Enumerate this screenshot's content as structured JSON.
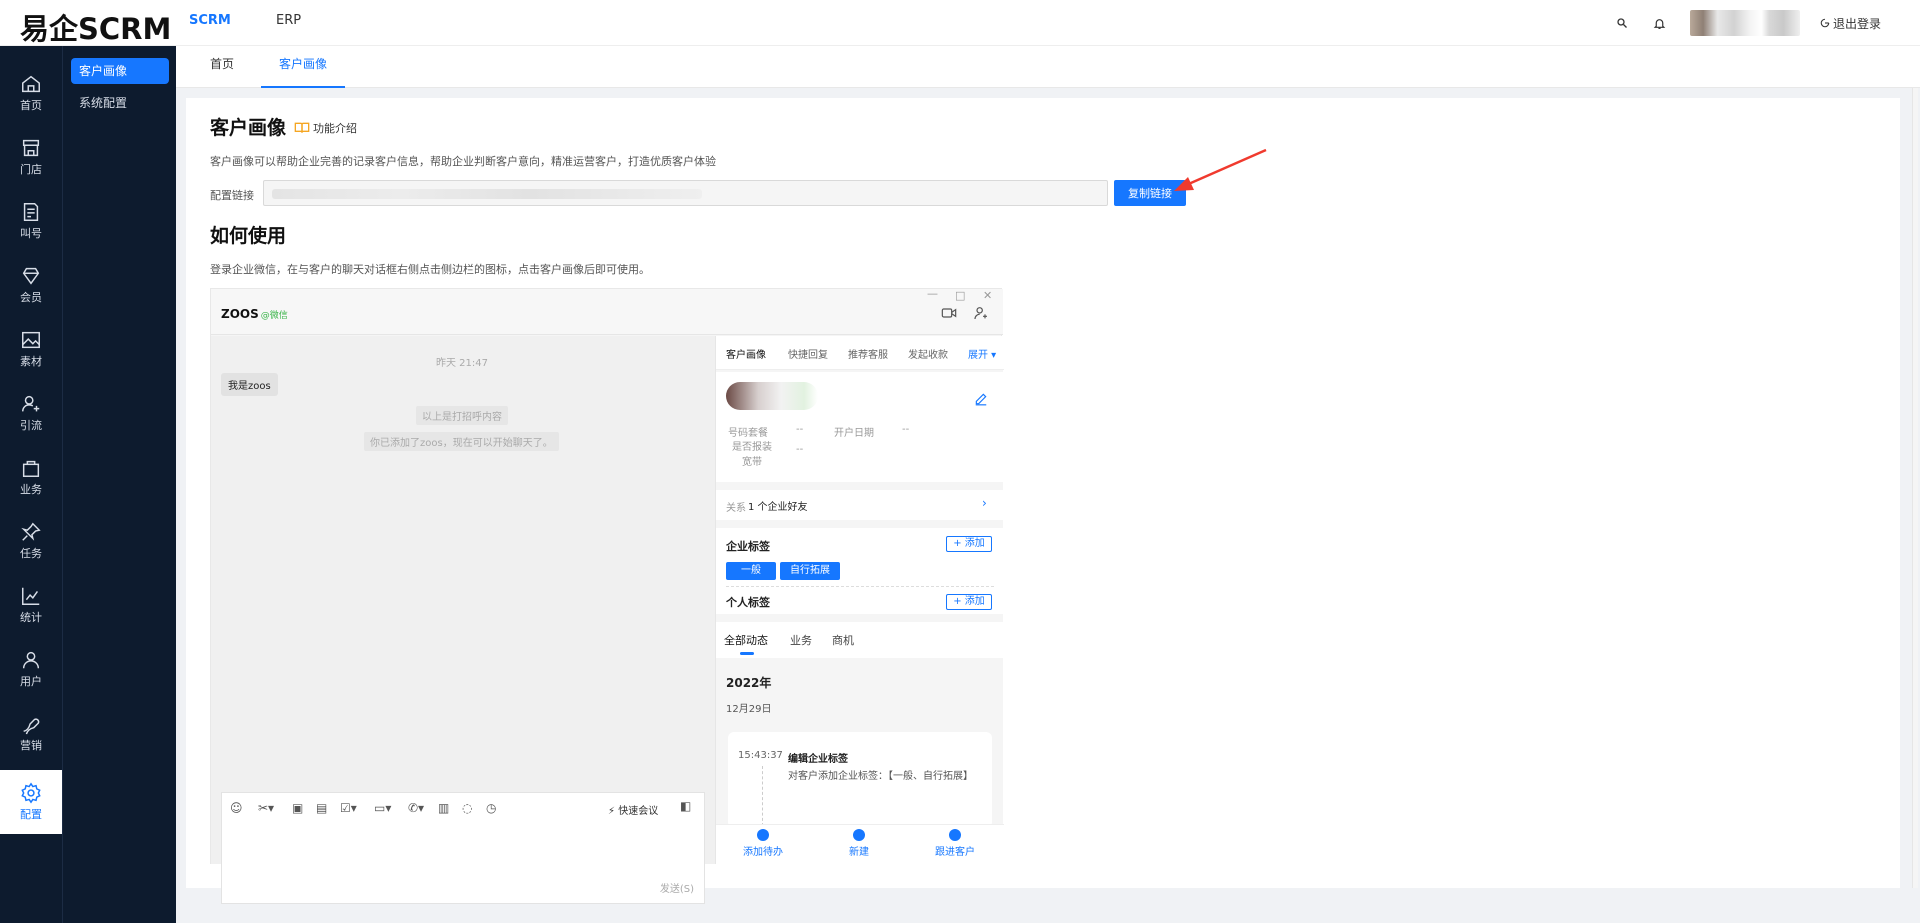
{
  "app": {
    "logo": "易企SCRM"
  },
  "topnav": [
    {
      "label": "SCRM"
    },
    {
      "label": "ERP"
    }
  ],
  "header_right": {
    "logout_label": "退出登录"
  },
  "sidebar": {
    "items": [
      {
        "label": "首页",
        "icon": "home-icon"
      },
      {
        "label": "门店",
        "icon": "store-icon"
      },
      {
        "label": "叫号",
        "icon": "ticket-icon"
      },
      {
        "label": "会员",
        "icon": "member-icon"
      },
      {
        "label": "素材",
        "icon": "image-icon"
      },
      {
        "label": "引流",
        "icon": "user-add-icon"
      },
      {
        "label": "业务",
        "icon": "bag-icon"
      },
      {
        "label": "任务",
        "icon": "pin-icon"
      },
      {
        "label": "统计",
        "icon": "chart-icon"
      },
      {
        "label": "用户",
        "icon": "user-icon"
      },
      {
        "label": "营销",
        "icon": "marketing-icon"
      },
      {
        "label": "配置",
        "icon": "gear-icon"
      }
    ],
    "active_index": 11
  },
  "subnav": [
    {
      "label": "客户画像"
    },
    {
      "label": "系统配置"
    }
  ],
  "tabs": [
    {
      "label": "首页"
    },
    {
      "label": "客户画像"
    }
  ],
  "content": {
    "title": "客户画像",
    "feature_label": "功能介绍",
    "description": "客户画像可以帮助企业完善的记录客户信息，帮助企业判断客户意向，精准运营客户，打造优质客户体验",
    "link_label": "配置链接",
    "copy_button": "复制链接",
    "how_title": "如何使用",
    "how_desc": "登录企业微信，在与客户的聊天对话框右侧点击侧边栏的图标，点击客户画像后即可使用。"
  },
  "wechat": {
    "contact_name": "ZOOS",
    "contact_tag": "@微信",
    "time": "昨天 21:47",
    "message": "我是zoos",
    "sys1": "以上是打招呼内容",
    "sys2": "你已添加了zoos，现在可以开始聊天了。",
    "quick_meeting": "快速会议",
    "send": "发送(S)",
    "panel_tabs": [
      "客户画像",
      "快捷回复",
      "推荐客服",
      "发起收款",
      "展开"
    ],
    "fields": [
      {
        "key": "号码套餐",
        "value": "--"
      },
      {
        "key": "开户日期",
        "value": "--"
      },
      {
        "key": "是否报装宽带",
        "value": "--"
      }
    ],
    "relation_label": "关系",
    "relation_value": "1 个企业好友",
    "corp_tags_label": "企业标签",
    "add_label": "+ 添加",
    "tags": [
      "一般",
      "自行拓展"
    ],
    "personal_tags_label": "个人标签",
    "activity_tabs": [
      "全部动态",
      "业务",
      "商机"
    ],
    "year": "2022年",
    "date": "12月29日",
    "event_time": "15:43:37",
    "event_title": "编辑企业标签",
    "event_detail": "对客户添加企业标签：【一般、自行拓展】",
    "bottom": [
      "添加待办",
      "新建",
      "跟进客户"
    ]
  },
  "colors": {
    "accent": "#1677ff",
    "sidebar_bg": "#0d1b2e",
    "arrow": "#f03a2e"
  }
}
